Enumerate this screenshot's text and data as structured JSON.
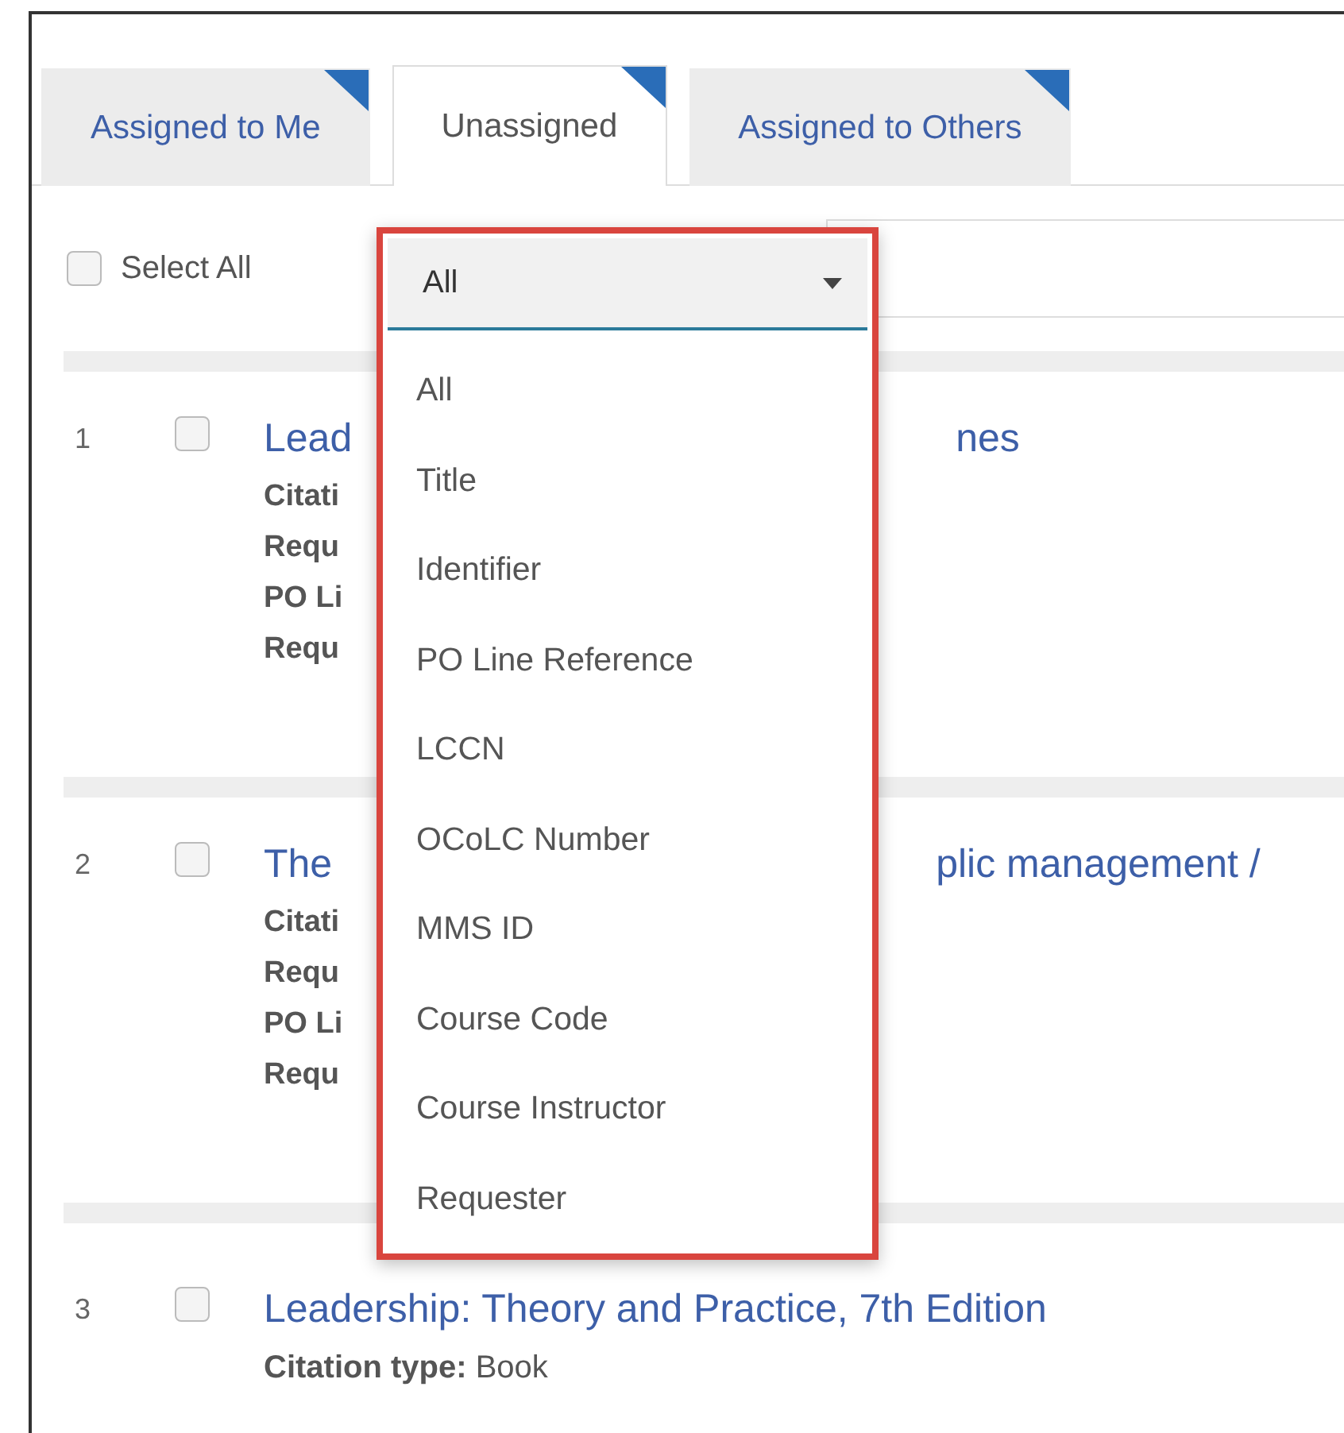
{
  "tabs": [
    {
      "label": "Assigned to Me",
      "selected": false
    },
    {
      "label": "Unassigned",
      "selected": true
    },
    {
      "label": "Assigned to Others",
      "selected": false
    }
  ],
  "select_all": {
    "label": "Select All",
    "checked": false
  },
  "filter_select": {
    "value": "All",
    "expanded": true
  },
  "dropdown_options": [
    {
      "label": "All"
    },
    {
      "label": "Title"
    },
    {
      "label": "Identifier"
    },
    {
      "label": "PO Line Reference"
    },
    {
      "label": "LCCN"
    },
    {
      "label": "OCoLC Number"
    },
    {
      "label": "MMS ID"
    },
    {
      "label": "Course Code"
    },
    {
      "label": "Course Instructor"
    },
    {
      "label": "Requester"
    }
  ],
  "results": [
    {
      "kind": "covered",
      "number": "1",
      "checked": false,
      "title_start": "Lead",
      "title_end": "nes",
      "field_labels": [
        "Citati",
        "Requ",
        "PO Li",
        "Requ"
      ]
    },
    {
      "kind": "covered",
      "number": "2",
      "checked": false,
      "title_start": "The",
      "title_end": "plic management /",
      "field_labels": [
        "Citati",
        "Requ",
        "PO Li",
        "Requ"
      ]
    },
    {
      "kind": "full",
      "number": "3",
      "checked": false,
      "title": "Leadership: Theory and Practice, 7th Edition",
      "fields": [
        "**Citation type:** Book"
      ]
    }
  ]
}
